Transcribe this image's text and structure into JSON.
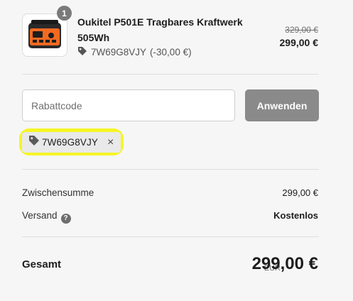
{
  "item": {
    "quantity": "1",
    "name": "Oukitel P501E Tragbares Kraftwerk 505Wh",
    "discount_code": "7W69G8VJY",
    "discount_amount": "(-30,00 €)",
    "price_original": "329,00 €",
    "price_final": "299,00 €"
  },
  "discount_form": {
    "placeholder": "Rabattcode",
    "value": "",
    "apply_label": "Anwenden"
  },
  "applied_code": {
    "code": "7W69G8VJY",
    "remove_icon": "×",
    "highlight_color": "#f4f500"
  },
  "summary": {
    "subtotal_label": "Zwischensumme",
    "subtotal_value": "299,00 €",
    "shipping_label": "Versand",
    "shipping_help_icon": "?",
    "shipping_value": "Kostenlos"
  },
  "total": {
    "label": "Gesamt",
    "currency": "EUR",
    "value": "299,00 €"
  },
  "colors": {
    "background": "#f6f6f6",
    "button": "#8a8a8a",
    "chip": "#e9e9e9"
  }
}
